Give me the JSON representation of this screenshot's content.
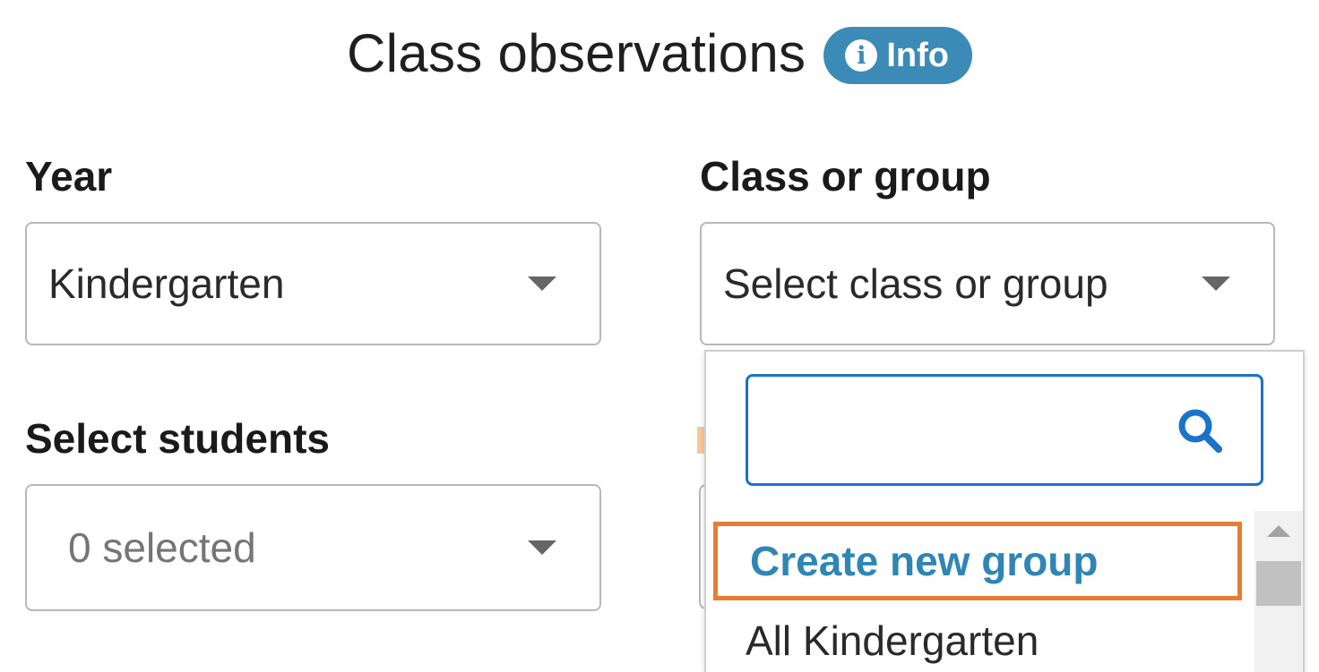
{
  "header": {
    "title": "Class observations",
    "info_badge": {
      "label": "Info",
      "icon": "info-circle-icon",
      "color": "#3b8bb6"
    }
  },
  "fields": {
    "year": {
      "label": "Year",
      "value": "Kindergarten"
    },
    "class_or_group": {
      "label": "Class or group",
      "placeholder": "Select class or group"
    },
    "students": {
      "label": "Select students",
      "value": "0 selected"
    }
  },
  "dropdown": {
    "search": {
      "value": "",
      "icon": "search-icon"
    },
    "options": [
      {
        "label": "Create new group",
        "highlighted": true
      },
      {
        "label": "All Kindergarten"
      }
    ]
  },
  "colors": {
    "accent": "#2f86b5",
    "highlight_border": "#e67e32",
    "search_border": "#1a73c9"
  }
}
